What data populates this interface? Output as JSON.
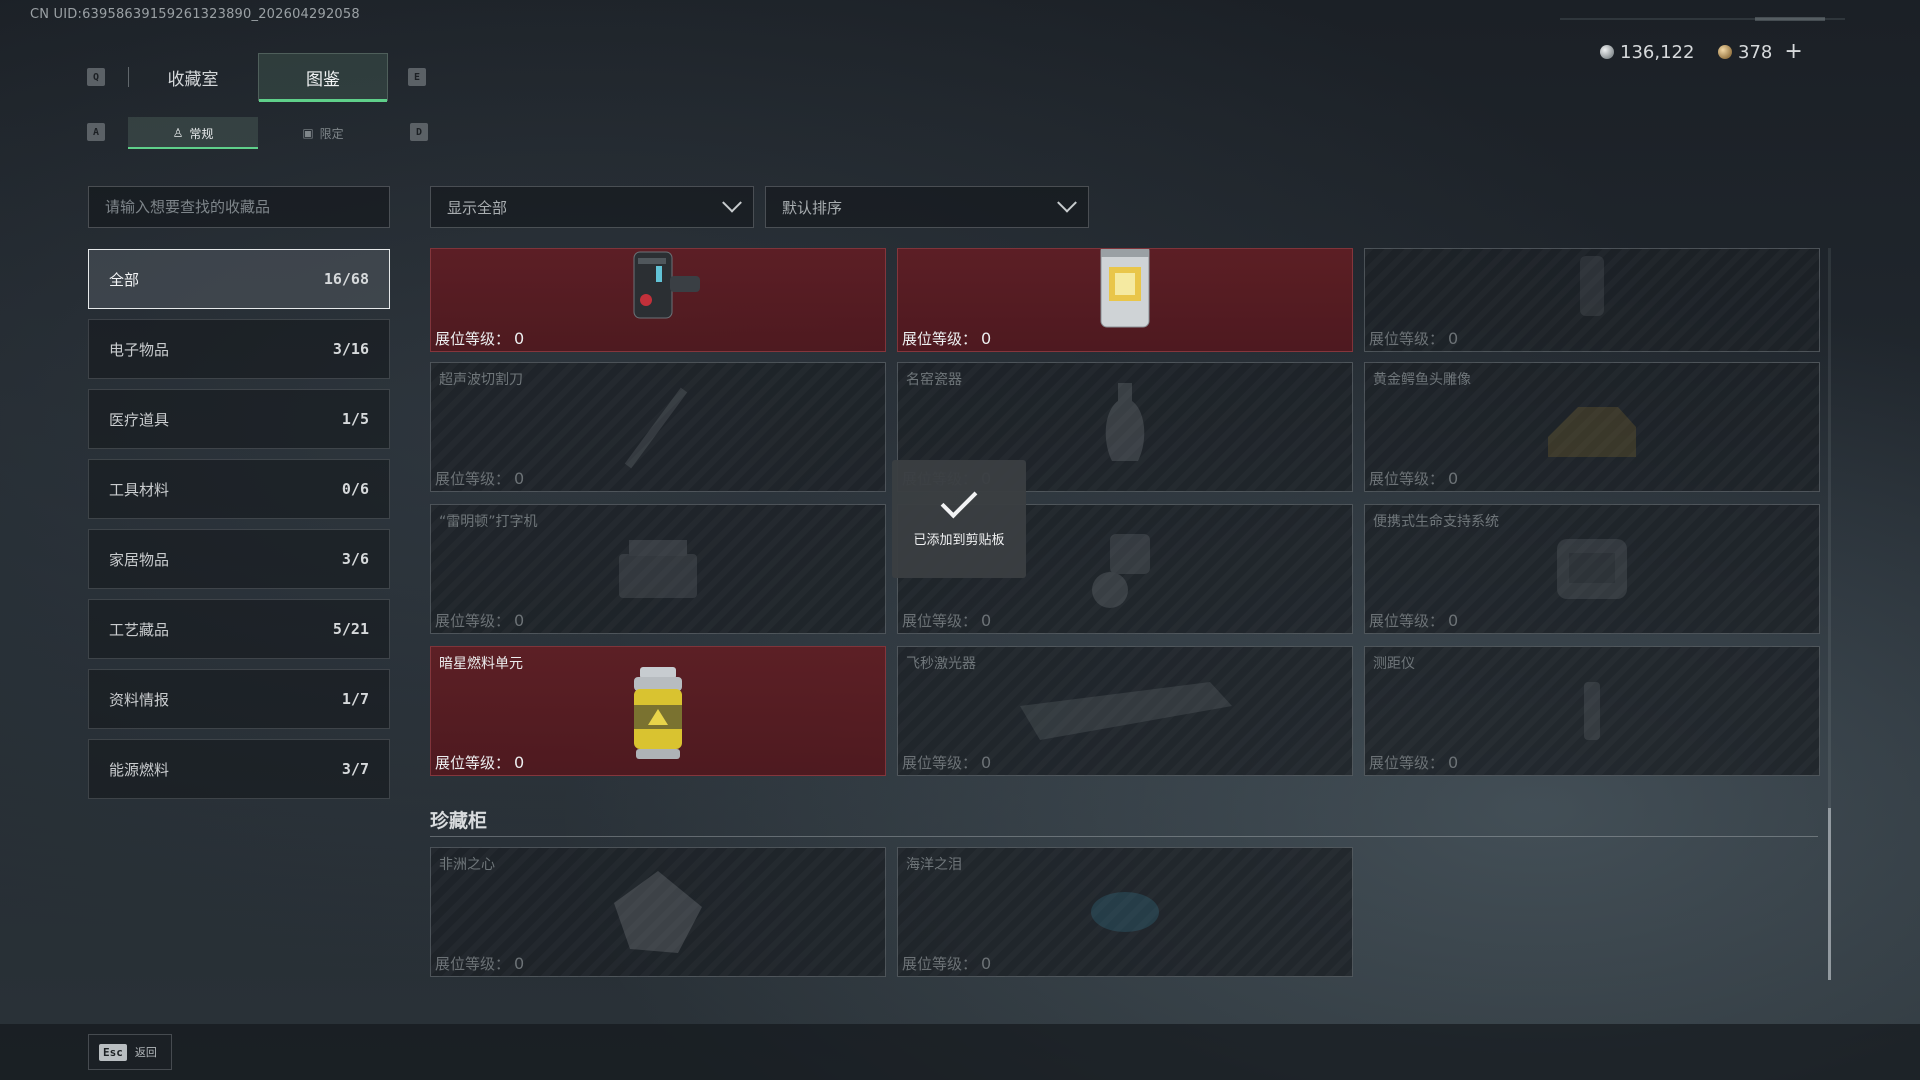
{
  "header": {
    "uid": "CN UID:63958639159261323890_202604292058",
    "currency": [
      {
        "icon": "silver-coin-icon",
        "value": "136,122"
      },
      {
        "icon": "gold-coin-icon",
        "value": "378"
      }
    ],
    "plus_label": "+"
  },
  "keys": {
    "prev_tab": "Q",
    "next_tab": "E",
    "prev_sub": "A",
    "next_sub": "D"
  },
  "tabs": [
    {
      "label": "收藏室",
      "active": false
    },
    {
      "label": "图鉴",
      "active": true
    }
  ],
  "subtabs": [
    {
      "label": "常规",
      "icon": "person-icon",
      "active": true
    },
    {
      "label": "限定",
      "icon": "limited-icon",
      "active": false
    }
  ],
  "search": {
    "placeholder": "请输入想要查找的收藏品",
    "value": ""
  },
  "filters": {
    "show": "显示全部",
    "sort": "默认排序"
  },
  "categories": [
    {
      "label": "全部",
      "count": "16/68",
      "active": true
    },
    {
      "label": "电子物品",
      "count": "3/16"
    },
    {
      "label": "医疗道具",
      "count": "1/5"
    },
    {
      "label": "工具材料",
      "count": "0/6"
    },
    {
      "label": "家居物品",
      "count": "3/6"
    },
    {
      "label": "工艺藏品",
      "count": "5/21"
    },
    {
      "label": "资料情报",
      "count": "1/7"
    },
    {
      "label": "能源燃料",
      "count": "3/7"
    }
  ],
  "level_label": "展位等级：",
  "grid": [
    {
      "name": "",
      "level": "0",
      "owned": true,
      "art": "device-icon"
    },
    {
      "name": "",
      "level": "0",
      "owned": true,
      "art": "reactor-icon"
    },
    {
      "name": "",
      "level": "0",
      "owned": false,
      "art": "lamp-icon"
    },
    {
      "name": "超声波切割刀",
      "level": "0",
      "owned": false,
      "art": "knife-icon"
    },
    {
      "name": "名窑瓷器",
      "level": "0",
      "owned": false,
      "art": "vase-icon"
    },
    {
      "name": "黄金鳄鱼头雕像",
      "level": "0",
      "owned": false,
      "art": "statue-icon"
    },
    {
      "name": "“雷明顿”打字机",
      "level": "0",
      "owned": false,
      "art": "typewriter-icon"
    },
    {
      "name": "",
      "level": "0",
      "owned": false,
      "art": "projector-icon"
    },
    {
      "name": "便携式生命支持系统",
      "level": "0",
      "owned": false,
      "art": "life-support-icon"
    },
    {
      "name": "暗星燃料单元",
      "level": "0",
      "owned": true,
      "art": "fuel-canister-icon"
    },
    {
      "name": "飞秒激光器",
      "level": "0",
      "owned": false,
      "art": "laser-icon"
    },
    {
      "name": "测距仪",
      "level": "0",
      "owned": false,
      "art": "rangefinder-icon"
    }
  ],
  "showcase": {
    "title": "珍藏柜",
    "items": [
      {
        "name": "非洲之心",
        "level": "0",
        "owned": false,
        "art": "gem-icon"
      },
      {
        "name": "海洋之泪",
        "level": "0",
        "owned": false,
        "art": "pendant-icon"
      }
    ]
  },
  "toast": {
    "message": "已添加到剪贴板",
    "icon": "check-icon"
  },
  "footer": {
    "esc_key": "Esc",
    "back_label": "返回"
  },
  "colors": {
    "accent": "#5fd08a",
    "owned_card": "#5f1e24",
    "unowned_card": "#1c2126"
  }
}
